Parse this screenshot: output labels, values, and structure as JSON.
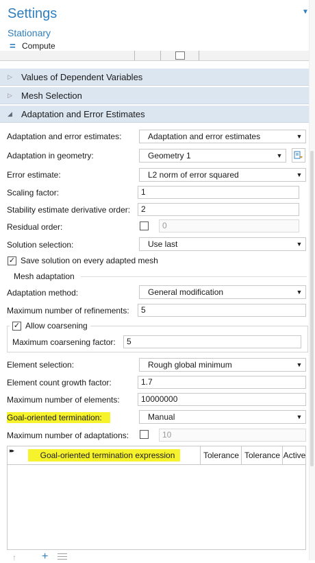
{
  "header": {
    "title": "Settings",
    "subtitle": "Stationary",
    "compute_label": "Compute"
  },
  "sections": [
    {
      "label": "Values of Dependent Variables",
      "expanded": false
    },
    {
      "label": "Mesh Selection",
      "expanded": false
    },
    {
      "label": "Adaptation and Error Estimates",
      "expanded": true
    }
  ],
  "form": {
    "adaptation_estimates": {
      "label": "Adaptation and error estimates:",
      "value": "Adaptation and error estimates"
    },
    "adaptation_geometry": {
      "label": "Adaptation in geometry:",
      "value": "Geometry 1"
    },
    "error_estimate": {
      "label": "Error estimate:",
      "value": "L2 norm of error squared"
    },
    "scaling_factor": {
      "label": "Scaling factor:",
      "value": "1"
    },
    "stability_order": {
      "label": "Stability estimate derivative order:",
      "value": "2"
    },
    "residual_order": {
      "label": "Residual order:",
      "checked": false,
      "value": "0"
    },
    "solution_selection": {
      "label": "Solution selection:",
      "value": "Use last"
    },
    "save_solution": {
      "label": "Save solution on every adapted mesh",
      "checked": true
    },
    "mesh_adaptation_group": "Mesh adaptation",
    "adaptation_method": {
      "label": "Adaptation method:",
      "value": "General modification"
    },
    "max_refinements": {
      "label": "Maximum number of refinements:",
      "value": "5"
    },
    "allow_coarsening": {
      "label": "Allow coarsening",
      "checked": true
    },
    "max_coarsening": {
      "label": "Maximum coarsening factor:",
      "value": "5"
    },
    "element_selection": {
      "label": "Element selection:",
      "value": "Rough global minimum"
    },
    "growth_factor": {
      "label": "Element count growth factor:",
      "value": "1.7"
    },
    "max_elements": {
      "label": "Maximum number of elements:",
      "value": "10000000"
    },
    "goal_termination": {
      "label": "Goal-oriented termination:",
      "value": "Manual"
    },
    "max_adaptations": {
      "label": "Maximum number of adaptations:",
      "checked": false,
      "value": "10"
    }
  },
  "table": {
    "expand_glyph": "▸▸",
    "columns": [
      "Goal-oriented termination expression",
      "Tolerance",
      "Tolerance",
      "Active"
    ]
  },
  "colors": {
    "accent": "#2f7fbf",
    "section_bg": "#dce6f1",
    "highlight": "#f6f22b"
  }
}
